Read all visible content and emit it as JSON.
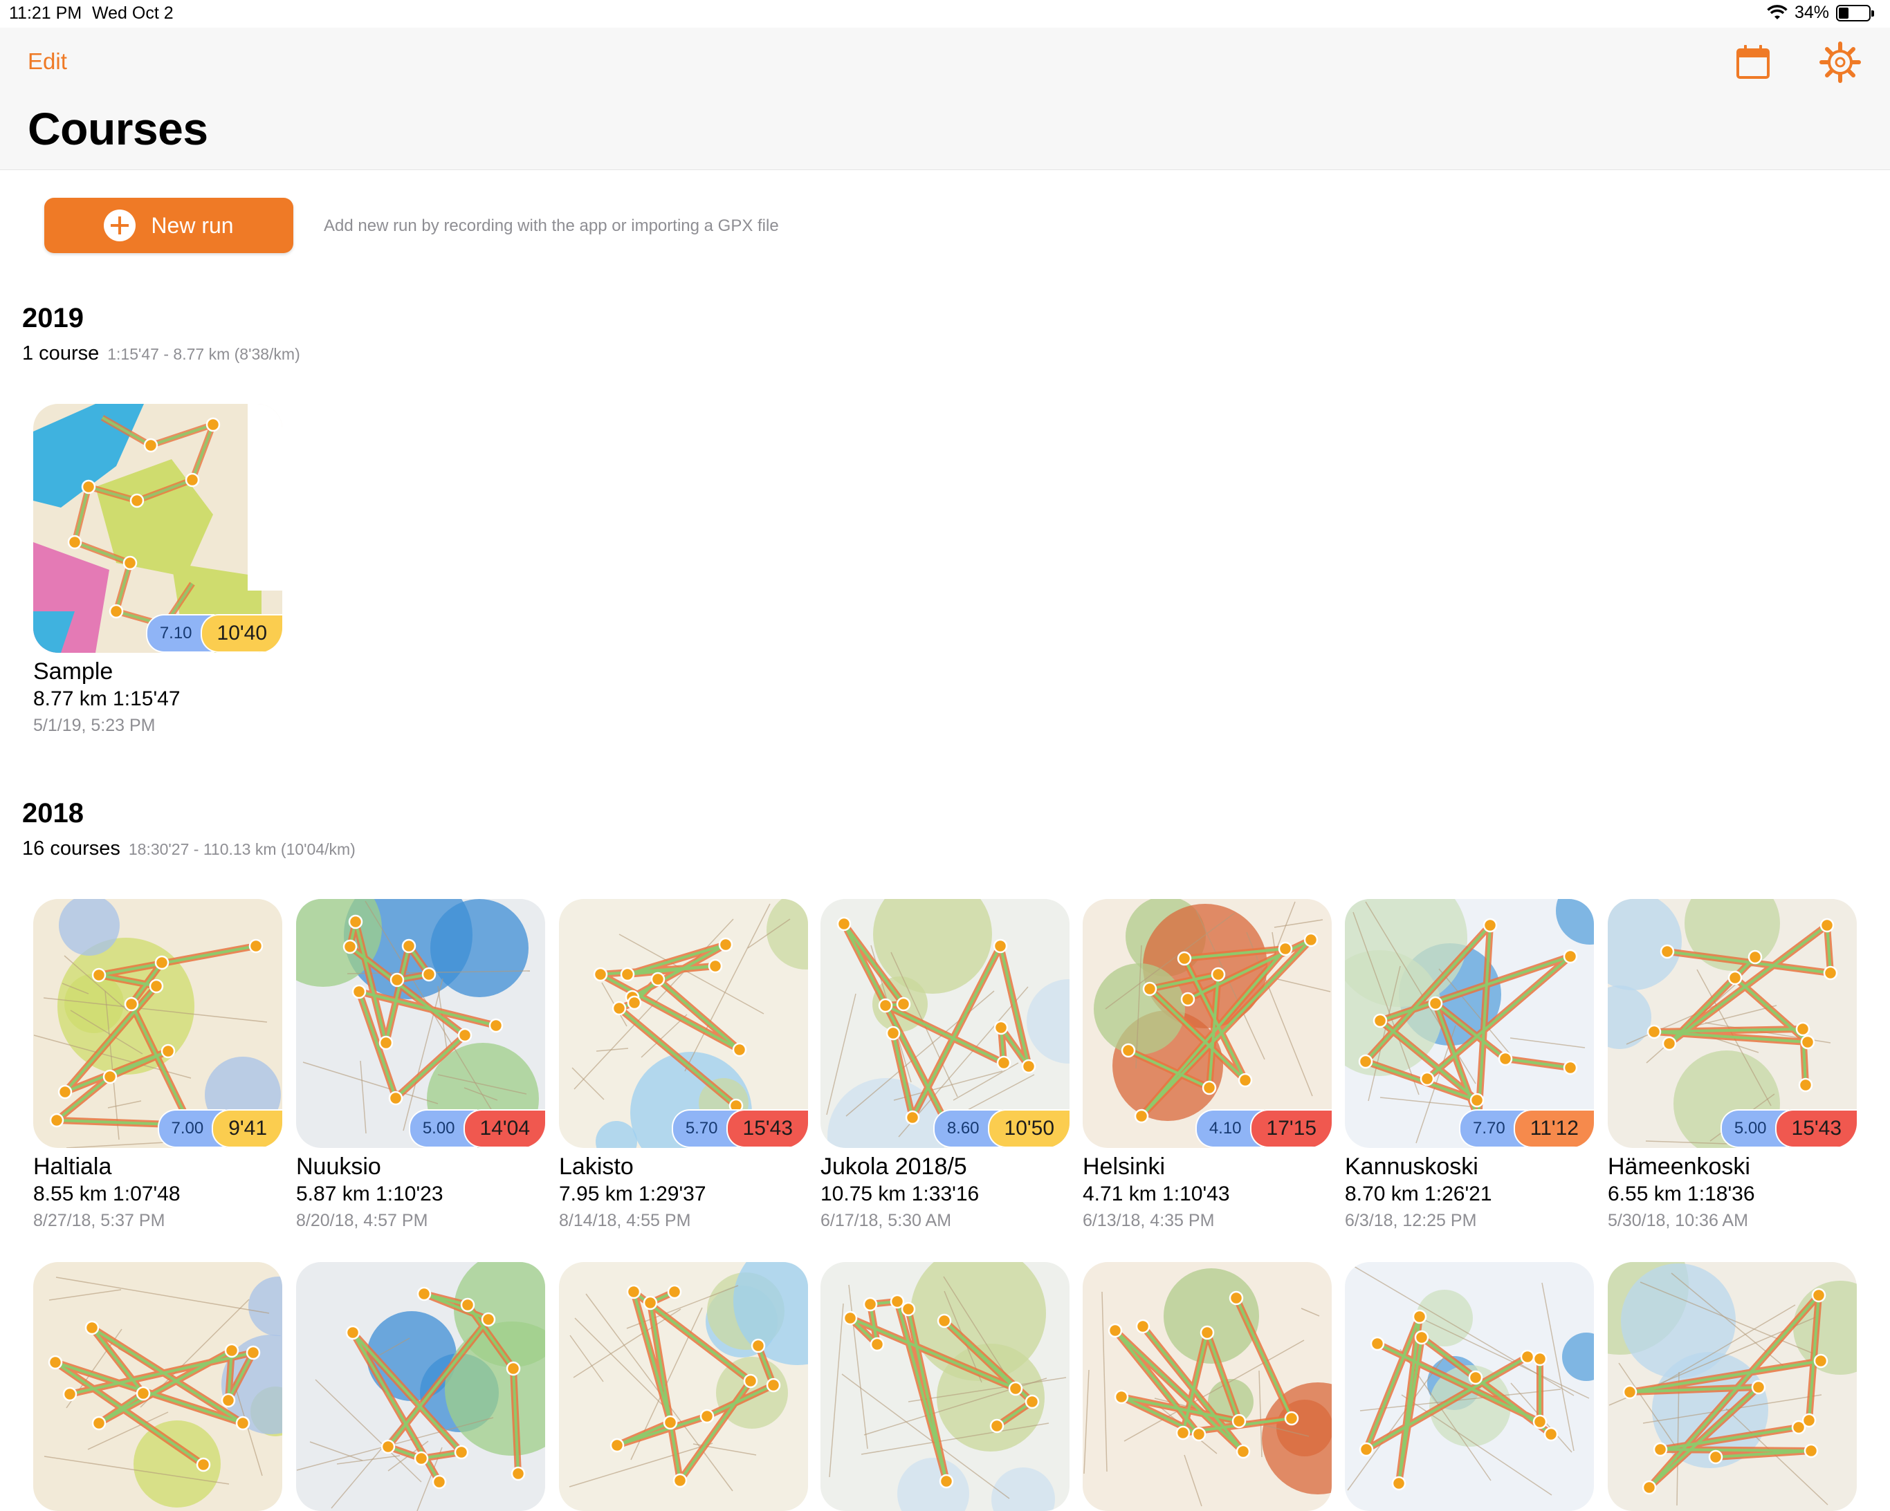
{
  "status": {
    "time": "11:21 PM",
    "date": "Wed Oct 2",
    "battery": "34%",
    "battery_level": 0.34
  },
  "nav": {
    "edit": "Edit",
    "title": "Courses",
    "calendar_icon": "calendar-icon",
    "settings_icon": "gear-icon"
  },
  "new_run": {
    "label": "New run",
    "hint": "Add new run by recording with the app or importing a GPX file"
  },
  "colors": {
    "accent": "#ef7a26",
    "distance_badge": "#8fb4f6",
    "time_yellow": "#fbcd4f",
    "time_red": "#f0584f",
    "time_orange": "#f68a4c"
  },
  "sections": [
    {
      "year": "2019",
      "count": "1 course",
      "meta": "1:15'47 - 8.77 km (8'38/km)",
      "courses": [
        {
          "name": "Sample",
          "stats": "8.77 km 1:15'47",
          "date": "5/1/19, 5:23 PM",
          "badge_dist": "7.10",
          "badge_time": "10'40",
          "badge_color": "yellow"
        }
      ]
    },
    {
      "year": "2018",
      "count": "16 courses",
      "meta": "18:30'27 - 110.13 km (10'04/km)",
      "courses": [
        {
          "name": "Haltiala",
          "stats": "8.55 km 1:07'48",
          "date": "8/27/18, 5:37 PM",
          "badge_dist": "7.00",
          "badge_time": "9'41",
          "badge_color": "yellow"
        },
        {
          "name": "Nuuksio",
          "stats": "5.87 km 1:10'23",
          "date": "8/20/18, 4:57 PM",
          "badge_dist": "5.00",
          "badge_time": "14'04",
          "badge_color": "red"
        },
        {
          "name": "Lakisto",
          "stats": "7.95 km 1:29'37",
          "date": "8/14/18, 4:55 PM",
          "badge_dist": "5.70",
          "badge_time": "15'43",
          "badge_color": "red"
        },
        {
          "name": "Jukola 2018/5",
          "stats": "10.75 km 1:33'16",
          "date": "6/17/18, 5:30 AM",
          "badge_dist": "8.60",
          "badge_time": "10'50",
          "badge_color": "yellow"
        },
        {
          "name": "Helsinki",
          "stats": "4.71 km 1:10'43",
          "date": "6/13/18, 4:35 PM",
          "badge_dist": "4.10",
          "badge_time": "17'15",
          "badge_color": "red"
        },
        {
          "name": "Kannuskoski",
          "stats": "8.70 km 1:26'21",
          "date": "6/3/18, 12:25 PM",
          "badge_dist": "7.70",
          "badge_time": "11'12",
          "badge_color": "orange"
        },
        {
          "name": "Hämeenkoski",
          "stats": "6.55 km 1:18'36",
          "date": "5/30/18, 10:36 AM",
          "badge_dist": "5.00",
          "badge_time": "15'43",
          "badge_color": "red"
        }
      ]
    },
    {
      "courses": [
        {},
        {},
        {},
        {},
        {},
        {},
        {}
      ]
    }
  ]
}
